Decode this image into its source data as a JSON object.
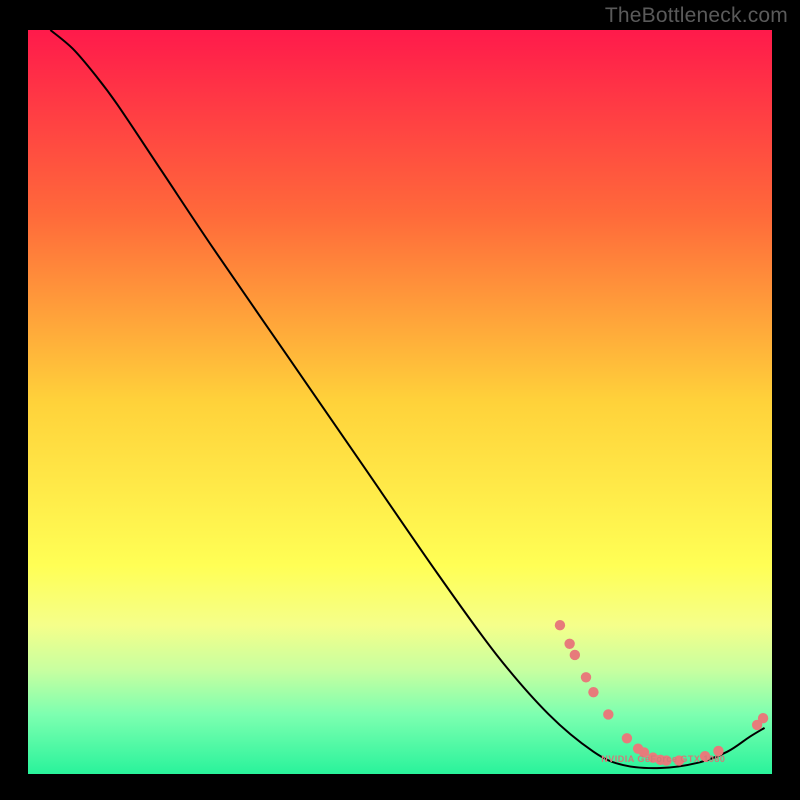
{
  "watermark": "TheBottleneck.com",
  "annotation_label": "NVIDIA GeForce GTX 1080",
  "chart_data": {
    "type": "line",
    "title": "",
    "xlabel": "",
    "ylabel": "",
    "xlim": [
      0,
      100
    ],
    "ylim": [
      0,
      100
    ],
    "gradient_stops": [
      {
        "offset": 0.0,
        "color": "#ff1a4b"
      },
      {
        "offset": 0.25,
        "color": "#ff6a3a"
      },
      {
        "offset": 0.5,
        "color": "#ffd23a"
      },
      {
        "offset": 0.72,
        "color": "#ffff55"
      },
      {
        "offset": 0.8,
        "color": "#f5ff8a"
      },
      {
        "offset": 0.86,
        "color": "#c8ffa0"
      },
      {
        "offset": 0.92,
        "color": "#7dffb0"
      },
      {
        "offset": 1.0,
        "color": "#29f39b"
      }
    ],
    "curve": [
      {
        "x": 3,
        "y": 100
      },
      {
        "x": 6,
        "y": 97.5
      },
      {
        "x": 9,
        "y": 94
      },
      {
        "x": 12,
        "y": 90
      },
      {
        "x": 18,
        "y": 81
      },
      {
        "x": 25,
        "y": 70.5
      },
      {
        "x": 35,
        "y": 56
      },
      {
        "x": 45,
        "y": 41.5
      },
      {
        "x": 55,
        "y": 27
      },
      {
        "x": 63,
        "y": 16
      },
      {
        "x": 70,
        "y": 8
      },
      {
        "x": 76,
        "y": 3
      },
      {
        "x": 80,
        "y": 1.2
      },
      {
        "x": 85,
        "y": 0.8
      },
      {
        "x": 90,
        "y": 1.5
      },
      {
        "x": 94,
        "y": 3
      },
      {
        "x": 97,
        "y": 5
      },
      {
        "x": 99,
        "y": 6.2
      }
    ],
    "markers": [
      {
        "x": 71.5,
        "y": 20.0
      },
      {
        "x": 72.8,
        "y": 17.5
      },
      {
        "x": 73.5,
        "y": 16.0
      },
      {
        "x": 75.0,
        "y": 13.0
      },
      {
        "x": 76.0,
        "y": 11.0
      },
      {
        "x": 78.0,
        "y": 8.0
      },
      {
        "x": 80.5,
        "y": 4.8
      },
      {
        "x": 82.0,
        "y": 3.4
      },
      {
        "x": 82.8,
        "y": 2.9
      },
      {
        "x": 84.0,
        "y": 2.2
      },
      {
        "x": 85.0,
        "y": 1.9
      },
      {
        "x": 85.8,
        "y": 1.8
      },
      {
        "x": 87.5,
        "y": 1.8
      },
      {
        "x": 91.0,
        "y": 2.4
      },
      {
        "x": 92.8,
        "y": 3.1
      },
      {
        "x": 98.0,
        "y": 6.6
      },
      {
        "x": 98.8,
        "y": 7.5
      }
    ],
    "annotation_pos": {
      "x": 83.5,
      "y": 2.0
    }
  }
}
